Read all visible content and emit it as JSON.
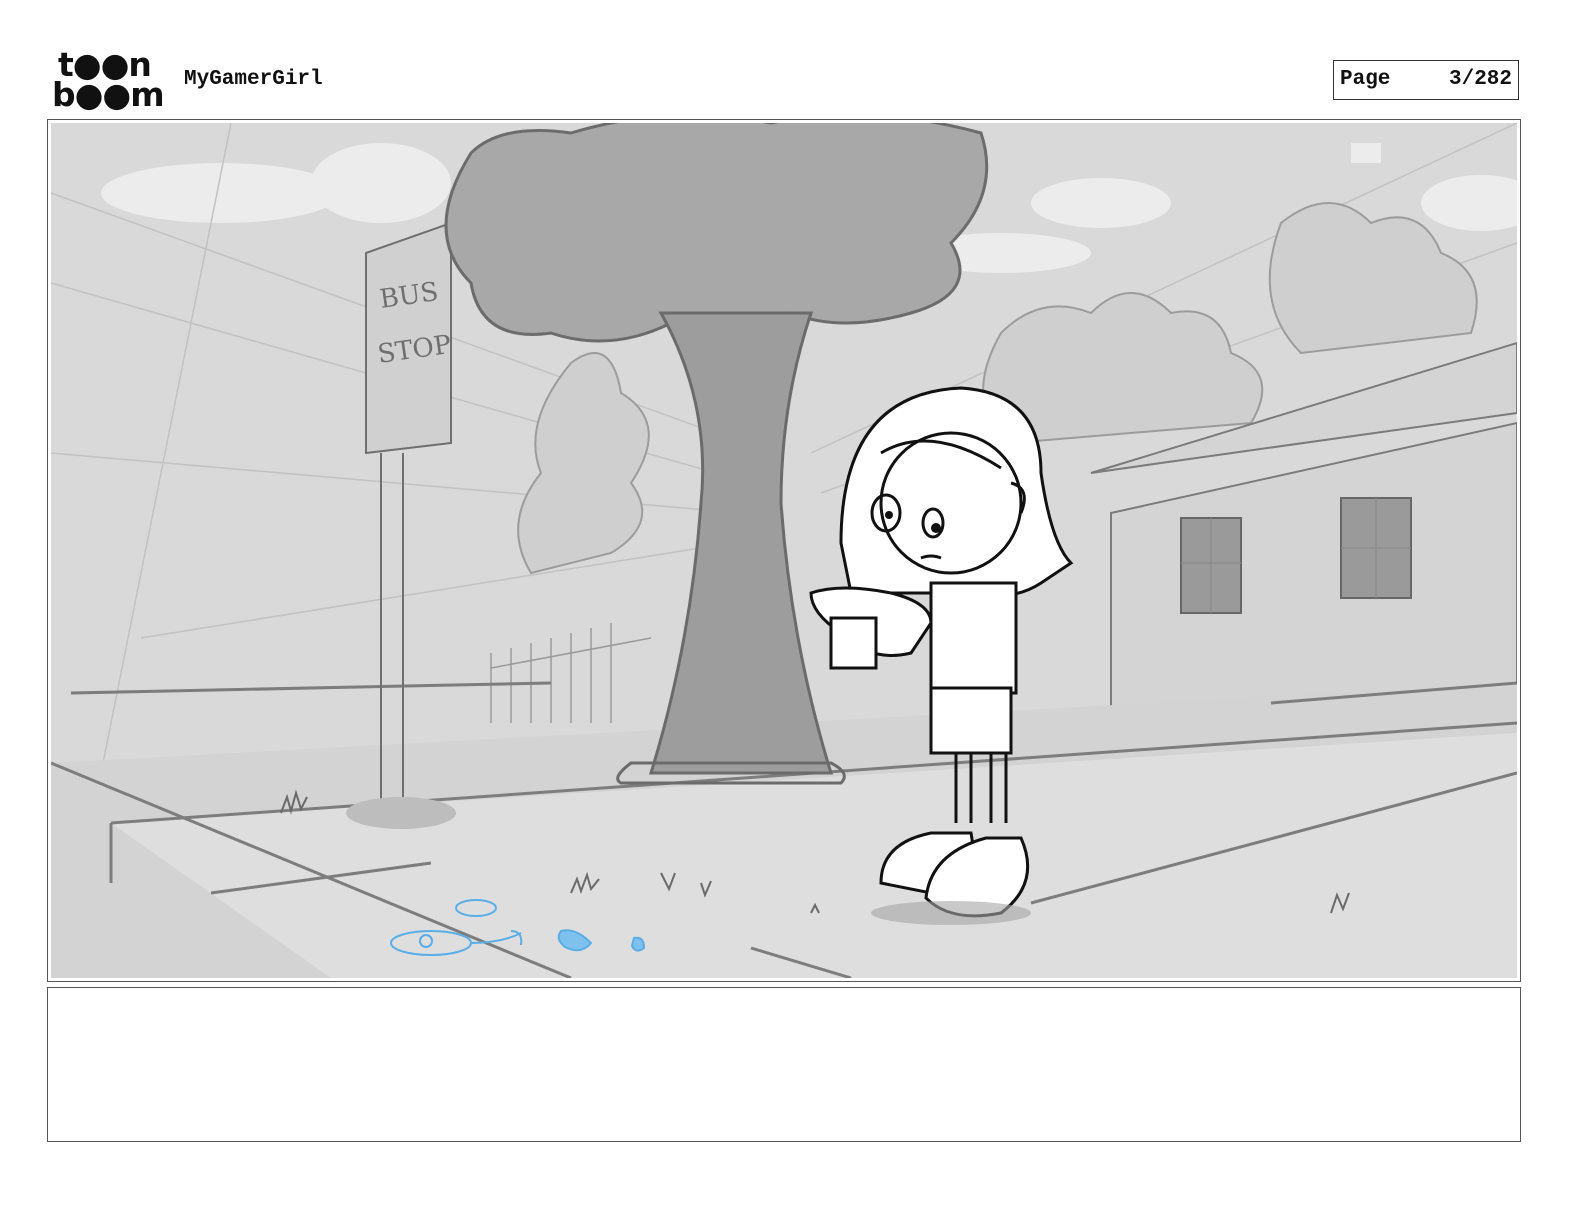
{
  "header": {
    "logo_line1": "t●●n",
    "logo_line2": "b●●m",
    "project_title": "MyGamerGirl",
    "page_label": "Page",
    "page_number": "3/282"
  },
  "panel": {
    "sign_line1": "BUS",
    "sign_line2": "STOP"
  },
  "notes": {
    "text": ""
  }
}
